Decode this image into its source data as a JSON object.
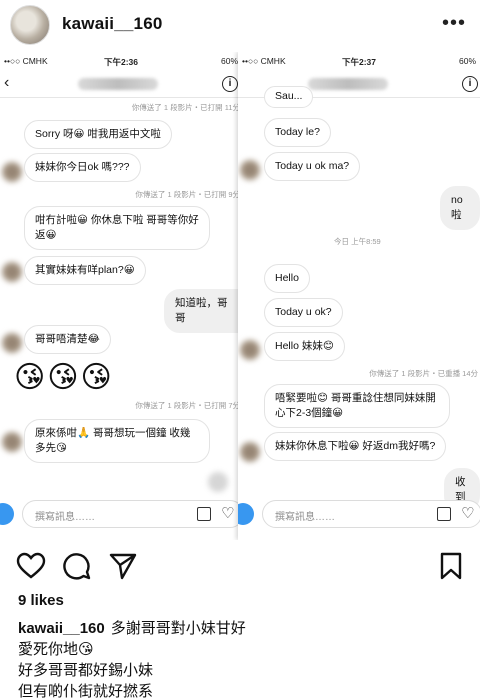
{
  "post": {
    "username": "kawaii__160",
    "more_icon": "more-horizontal-icon"
  },
  "left_screen": {
    "status": {
      "carrier": "••○○ CMHK",
      "time": "下午2:36",
      "right": "60%"
    },
    "meta_1": "你傳送了 1 段影片・已打開 11分",
    "bubble_1": "Sorry 呀😀 咁我用返中文啦",
    "bubble_2": "妹妹你今日ok 嗎???",
    "meta_2": "你傳送了 1 段影片・已打開 9分",
    "bubble_3": "咁冇計啦😀 你休息下啦 哥哥等你好返😀",
    "bubble_4": "其實妹妹有咩plan?😀",
    "bubble_me_1": "知道啦，哥哥",
    "bubble_5": "哥哥唔清楚😂",
    "emojis": "😘😘😘",
    "meta_3": "你傳送了 1 段影片・已打開 7分",
    "bubble_6": "原來係咁🙏 哥哥想玩一個鐘 收幾多先😘",
    "input_placeholder": "撰寫訊息……"
  },
  "right_screen": {
    "status": {
      "carrier": "••○○ CMHK",
      "time": "下午2:37",
      "right": "60%"
    },
    "bubble_top": "Sau...",
    "bubble_1": "Today le?",
    "bubble_2": "Today u ok ma?",
    "bubble_me_1": "no啦",
    "time_divider": "今日 上午8:59",
    "bubble_3": "Hello",
    "bubble_4": "Today u ok?",
    "bubble_5": "Hello 妹妹😊",
    "meta_1": "你傳送了 1 段影片・已重播 14分",
    "bubble_6": "唔緊要啦😊 哥哥重諗住想同妹妹開心下2-3個鐘😀",
    "bubble_7": "妹妹你休息下啦😀 好返dm我好嗎?",
    "bubble_me_2": "收到",
    "input_placeholder": "撰寫訊息……"
  },
  "actions": {
    "like_icon": "heart-icon",
    "comment_icon": "comment-icon",
    "share_icon": "send-icon",
    "save_icon": "bookmark-icon"
  },
  "likes": "9 likes",
  "caption": {
    "username": "kawaii__160",
    "line_1": "多謝哥哥對小妹甘好",
    "line_2": "愛死你地😘",
    "line_3": "好多哥哥都好錫小妹",
    "line_4": "但有啲仆街就好撚系"
  }
}
